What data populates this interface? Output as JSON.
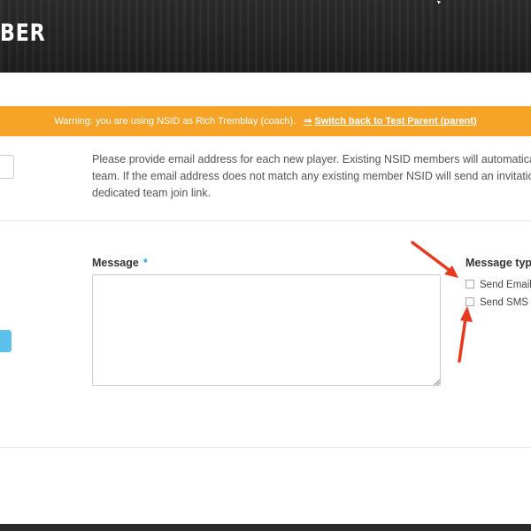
{
  "header": {
    "title": "BER"
  },
  "warning": {
    "text": "Warning: you are using NSID as Rich Tremblay (coach).",
    "switch_label": "Switch back to Test Parent (parent)",
    "switch_icon": "sign-in-icon",
    "background": "#f5a428"
  },
  "help_text": {
    "line1": "Please provide email address for each new player. Existing NSID members will automaticall",
    "line2": "team. If the email address does not match any existing member NSID will send an invitatio",
    "line3": "dedicated team join link."
  },
  "message": {
    "label": "Message",
    "required_mark": "*",
    "value": ""
  },
  "message_type": {
    "label": "Message type",
    "options": [
      {
        "label": "Send Email",
        "checked": false
      },
      {
        "label": "Send SMS",
        "checked": false
      }
    ]
  },
  "colors": {
    "accent": "#2fa4e7",
    "annotation_arrow": "#e8391f"
  }
}
